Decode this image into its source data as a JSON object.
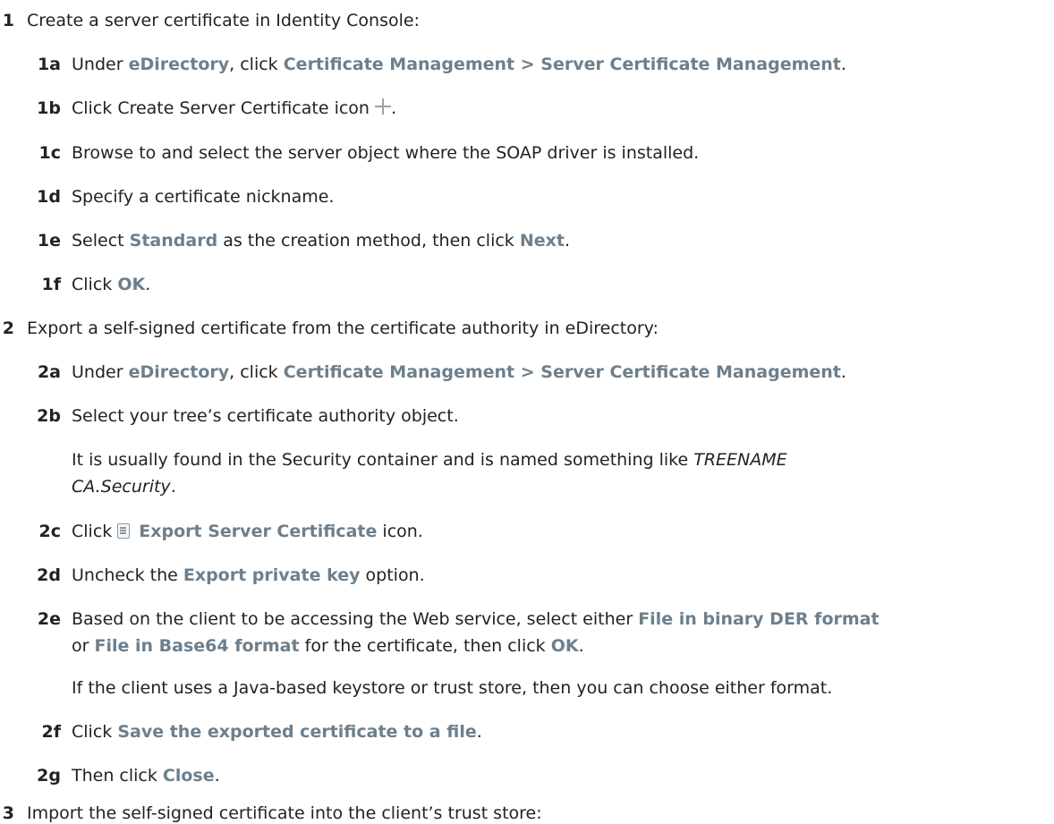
{
  "steps": [
    {
      "number": "1",
      "text": "Create a server certificate in Identity Console:",
      "substeps": [
        {
          "number": "1a",
          "t1": "Under ",
          "b1": "eDirectory",
          "t2": ", click ",
          "b2": "Certificate Management > Server Certificate Management",
          "t3": "."
        },
        {
          "number": "1b",
          "t1": "Click Create Server Certificate icon",
          "t2": "."
        },
        {
          "number": "1c",
          "t1": "Browse to and select the server object where the SOAP driver is installed."
        },
        {
          "number": "1d",
          "t1": "Specify a certificate nickname."
        },
        {
          "number": "1e",
          "t1": "Select ",
          "b1": "Standard",
          "t2": " as the creation method, then click ",
          "b2": "Next",
          "t3": "."
        },
        {
          "number": "1f",
          "t1": "Click ",
          "b1": "OK",
          "t2": "."
        }
      ]
    },
    {
      "number": "2",
      "text": "Export a self-signed certificate from the certificate authority in eDirectory:",
      "substeps": [
        {
          "number": "2a",
          "t1": "Under ",
          "b1": "eDirectory",
          "t2": ", click ",
          "b2": "Certificate Management > Server Certificate Management",
          "t3": "."
        },
        {
          "number": "2b",
          "t1": "Select your tree’s certificate authority object.",
          "note1": "It is usually found in the Security container and is named something like ",
          "note_italic1": "TREENAME",
          "note_italic2": "CA.Security",
          "note_end": "."
        },
        {
          "number": "2c",
          "t1": "Click",
          "b1": "Export Server Certificate",
          "t2": " icon."
        },
        {
          "number": "2d",
          "t1": "Uncheck the ",
          "b1": "Export private key",
          "t2": " option."
        },
        {
          "number": "2e",
          "t1": "Based on the client to be accessing the Web service, select either ",
          "b1": "File in binary DER format",
          "t2": "or ",
          "b2": "File in Base64 format",
          "t3": " for the certificate, then click ",
          "b3": "OK",
          "t4": ".",
          "note": "If the client uses a Java-based keystore or trust store, then you can choose either format."
        },
        {
          "number": "2f",
          "t1": "Click ",
          "b1": "Save the exported certificate to a file",
          "t2": "."
        },
        {
          "number": "2g",
          "t1": "Then click ",
          "b1": "Close",
          "t2": "."
        }
      ]
    },
    {
      "number": "3",
      "text": "Import the self-signed certificate into the client’s trust store:"
    }
  ],
  "icons": {
    "create": "plus-icon",
    "export": "export-certificate-icon"
  }
}
